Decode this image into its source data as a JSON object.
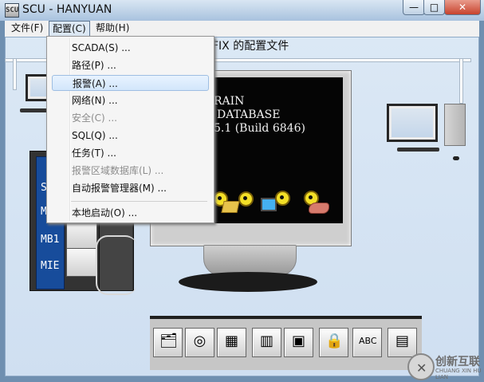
{
  "window": {
    "title": "SCU - HANYUAN",
    "app_icon": "SCU",
    "controls": {
      "minimize": "—",
      "maximize": "□",
      "close": "✕"
    }
  },
  "menubar": {
    "items": [
      "文件(F)",
      "配置(C)",
      "帮助(H)"
    ]
  },
  "dropdown": {
    "items": [
      {
        "label": "SCADA(S) ...",
        "enabled": true,
        "highlight": false
      },
      {
        "label": "路径(P) ...",
        "enabled": true,
        "highlight": false
      },
      {
        "label": "报警(A) ...",
        "enabled": true,
        "highlight": true
      },
      {
        "label": "网络(N) ...",
        "enabled": true,
        "highlight": false
      },
      {
        "label": "安全(C) ...",
        "enabled": false,
        "highlight": false
      },
      {
        "label": "SQL(Q) ...",
        "enabled": true,
        "highlight": false
      },
      {
        "label": "任务(T) ...",
        "enabled": true,
        "highlight": false
      },
      {
        "label": "报警区域数据库(L) ...",
        "enabled": false,
        "highlight": false
      },
      {
        "label": "自动报警管理器(M) ...",
        "enabled": true,
        "highlight": false
      },
      {
        "label": "本地启动(O) ...",
        "enabled": true,
        "highlight": false
      }
    ]
  },
  "content": {
    "config_title": "FIX 的配置文件",
    "screen_lines": [
      "RAIN",
      "DATABASE",
      "5.1 (Build 6846)"
    ],
    "rack_labels": [
      "SI",
      "MB",
      "MB1",
      "MIE"
    ]
  },
  "toolbar": {
    "buttons": [
      {
        "name": "folder-tree-icon",
        "glyph": "🗂"
      },
      {
        "name": "alarm-flow-icon",
        "glyph": "◎"
      },
      {
        "name": "network-config-icon",
        "glyph": "▦"
      },
      {
        "name": "database-icon",
        "glyph": "▥"
      },
      {
        "name": "dialog-settings-icon",
        "glyph": "▣"
      },
      {
        "name": "security-lock-icon",
        "glyph": "🔒"
      },
      {
        "name": "abc-tools-icon",
        "glyph": "ABC"
      },
      {
        "name": "report-tool-icon",
        "glyph": "▤"
      }
    ]
  },
  "watermark": {
    "brand": "创新互联",
    "mark": "✕",
    "sub": "CHUANG XIN HU LIAN"
  },
  "colors": {
    "desktop": "#cfdff1",
    "monitor_screen": "#050505",
    "menu_highlight": "#d2e6fb",
    "rack_blue": "#174c9b"
  }
}
